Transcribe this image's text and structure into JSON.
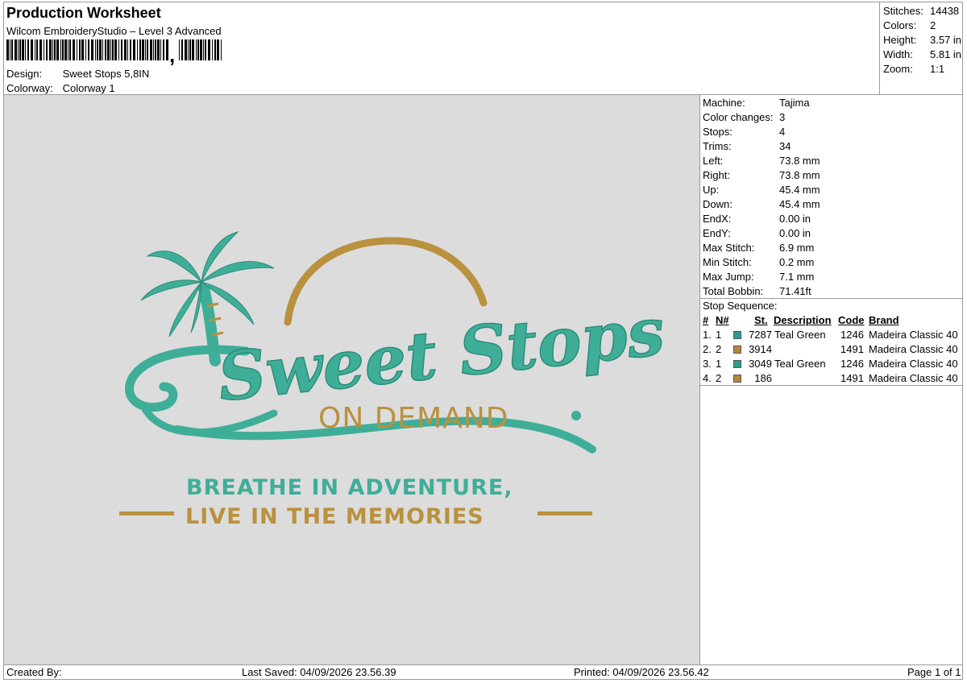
{
  "header": {
    "title": "Production Worksheet",
    "software": "Wilcom EmbroideryStudio – Level 3 Advanced",
    "design_label": "Design:",
    "design_value": "Sweet Stops 5,8IN",
    "colorway_label": "Colorway:",
    "colorway_value": "Colorway 1"
  },
  "stats": [
    {
      "label": "Stitches:",
      "value": "14438"
    },
    {
      "label": "Colors:",
      "value": "2"
    },
    {
      "label": "Height:",
      "value": "3.57 in"
    },
    {
      "label": "Width:",
      "value": "5.81 in"
    },
    {
      "label": "Zoom:",
      "value": "1:1"
    }
  ],
  "properties": [
    {
      "label": "Machine:",
      "value": "Tajima"
    },
    {
      "label": "Color changes:",
      "value": "3"
    },
    {
      "label": "Stops:",
      "value": "4"
    },
    {
      "label": "Trims:",
      "value": "34"
    },
    {
      "label": "Left:",
      "value": "73.8 mm"
    },
    {
      "label": "Right:",
      "value": "73.8 mm"
    },
    {
      "label": "Up:",
      "value": "45.4 mm"
    },
    {
      "label": "Down:",
      "value": "45.4 mm"
    },
    {
      "label": "EndX:",
      "value": "0.00 in"
    },
    {
      "label": "EndY:",
      "value": "0.00 in"
    },
    {
      "label": "Max Stitch:",
      "value": "6.9 mm"
    },
    {
      "label": "Min Stitch:",
      "value": "0.2 mm"
    },
    {
      "label": "Max Jump:",
      "value": "7.1 mm"
    },
    {
      "label": "Total Bobbin:",
      "value": "71.41ft"
    }
  ],
  "sequence": {
    "title": "Stop Sequence:",
    "headers": {
      "num": "#",
      "n": "N#",
      "st": "St.",
      "description": "Description",
      "code": "Code",
      "brand": "Brand"
    },
    "rows": [
      {
        "num": "1.",
        "n": "1",
        "color": "#2a9d8f",
        "st": "7287",
        "description": "Teal Green",
        "code": "1246",
        "brand": "Madeira Classic 40"
      },
      {
        "num": "2.",
        "n": "2",
        "color": "#b5873a",
        "st": "3914",
        "description": "",
        "code": "1491",
        "brand": "Madeira Classic 40"
      },
      {
        "num": "3.",
        "n": "1",
        "color": "#2a9d8f",
        "st": "3049",
        "description": "Teal Green",
        "code": "1246",
        "brand": "Madeira Classic 40"
      },
      {
        "num": "4.",
        "n": "2",
        "color": "#b5873a",
        "st": "186",
        "description": "",
        "code": "1491",
        "brand": "Madeira Classic 40"
      }
    ]
  },
  "design": {
    "main_text": "Sweet Stops",
    "sub_text": "ON DEMAND",
    "line1": "BREATHE IN ADVENTURE,",
    "line2": "LIVE IN THE  MEMORIES",
    "teal": "#3fae98",
    "gold": "#b9913f"
  },
  "footer": {
    "created_by": "Created By:",
    "last_saved": "Last Saved: 04/09/2026 23.56.39",
    "printed": "Printed: 04/09/2026 23.56.42",
    "page": "Page 1 of 1"
  }
}
